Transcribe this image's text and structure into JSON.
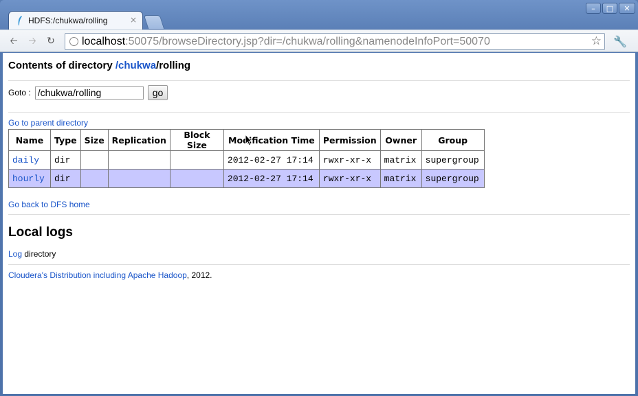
{
  "tab": {
    "title": "HDFS:/chukwa/rolling"
  },
  "address": {
    "host": "localhost",
    "rest": ":50075/browseDirectory.jsp?dir=/chukwa/rolling&namenodeInfoPort=50070"
  },
  "page": {
    "heading_prefix": "Contents of directory ",
    "heading_link": "/chukwa",
    "heading_suffix": "/rolling",
    "goto_label": "Goto :",
    "goto_value": "/chukwa/rolling",
    "goto_button": "go",
    "parent_link": "Go to parent directory",
    "home_link": "Go back to DFS home",
    "local_logs_title": "Local logs",
    "log_link": "Log",
    "log_suffix": " directory",
    "footer_link": "Cloudera's Distribution including Apache Hadoop",
    "footer_suffix": ", 2012."
  },
  "table": {
    "headers": [
      "Name",
      "Type",
      "Size",
      "Replication",
      "Block Size",
      "Modification Time",
      "Permission",
      "Owner",
      "Group"
    ],
    "rows": [
      [
        "daily",
        "dir",
        "",
        "",
        "",
        "2012-02-27 17:14",
        "rwxr-xr-x",
        "matrix",
        "supergroup"
      ],
      [
        "hourly",
        "dir",
        "",
        "",
        "",
        "2012-02-27 17:14",
        "rwxr-xr-x",
        "matrix",
        "supergroup"
      ]
    ]
  },
  "colors": {
    "link": "#1a55c9",
    "alt_row": "#c8c8ff",
    "window_frame": "#5a7eb3"
  },
  "icons": [
    "minimize-icon",
    "maximize-icon",
    "close-icon",
    "back-icon",
    "forward-icon",
    "reload-icon",
    "globe-icon",
    "star-icon",
    "wrench-icon"
  ]
}
